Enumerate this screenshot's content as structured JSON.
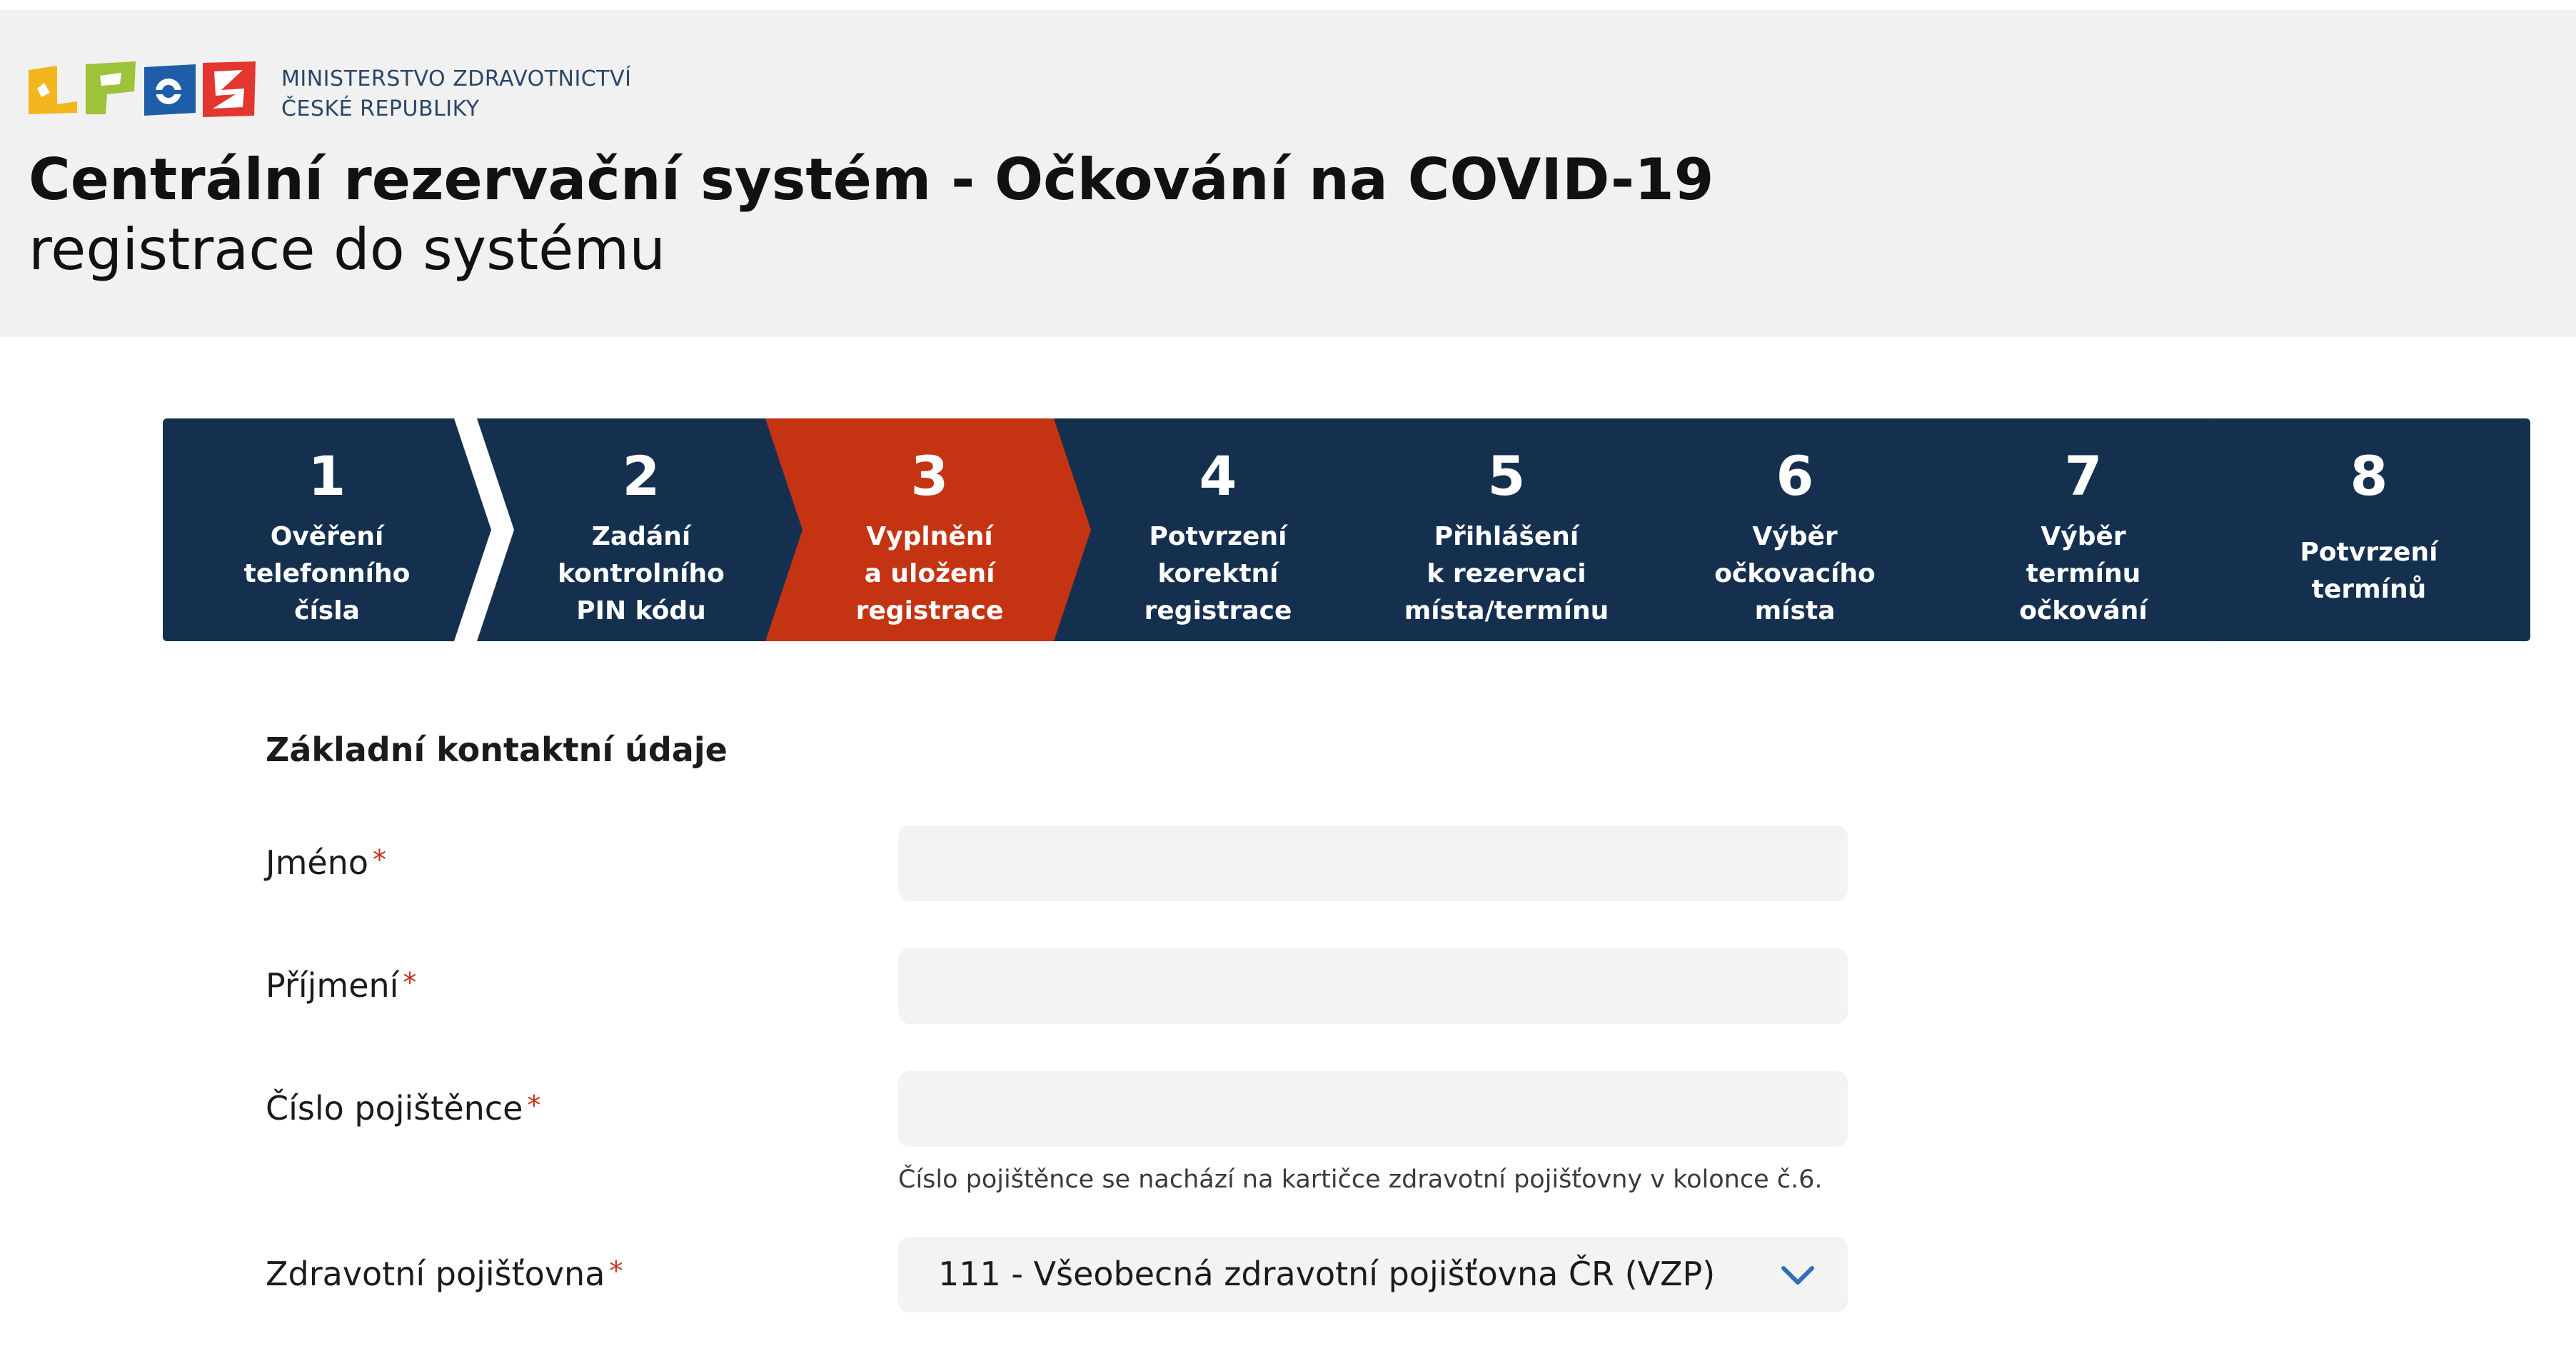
{
  "header": {
    "ministry_line1": "MINISTERSTVO ZDRAVOTNICTVÍ",
    "ministry_line2": "ČESKÉ REPUBLIKY",
    "title": "Centrální rezervační systém - Očkování na COVID-19",
    "subtitle": "registrace do systému",
    "logo_colors": [
      "#f2b61f",
      "#9cc33a",
      "#1e5ea8",
      "#e2362e"
    ]
  },
  "steps": [
    {
      "number": "1",
      "lines": [
        "Ověření",
        "telefonního",
        "čísla"
      ]
    },
    {
      "number": "2",
      "lines": [
        "Zadání",
        "kontrolního",
        "PIN kódu"
      ]
    },
    {
      "number": "3",
      "lines": [
        "Vyplnění",
        "a uložení",
        "registrace"
      ]
    },
    {
      "number": "4",
      "lines": [
        "Potvrzení",
        "korektní",
        "registrace"
      ]
    },
    {
      "number": "5",
      "lines": [
        "Přihlášení",
        "k rezervaci",
        "místa/termínu"
      ]
    },
    {
      "number": "6",
      "lines": [
        "Výběr",
        "očkovacího",
        "místa"
      ]
    },
    {
      "number": "7",
      "lines": [
        "Výběr",
        "termínu",
        "očkování"
      ]
    },
    {
      "number": "8",
      "lines": [
        "Potvrzení",
        "termínů"
      ]
    }
  ],
  "active_step": "3",
  "colors": {
    "step_default": "#15304f",
    "step_active": "#c43412",
    "required_mark": "#c43412",
    "field_background": "#f3f3f3"
  },
  "form": {
    "section_title": "Základní kontaktní údaje",
    "required_mark": "*",
    "fields": {
      "first_name": {
        "label": "Jméno",
        "value": ""
      },
      "last_name": {
        "label": "Příjmení",
        "value": ""
      },
      "insurance_number": {
        "label": "Číslo pojištěnce",
        "value": "",
        "hint": "Číslo pojištěnce se nachází na kartičce zdravotní pojišťovny v kolonce č.6."
      },
      "insurance_company": {
        "label": "Zdravotní pojišťovna",
        "selected": "111 - Všeobecná zdravotní pojišťovna ČR (VZP)",
        "icon": "chevron-down-icon"
      }
    }
  }
}
